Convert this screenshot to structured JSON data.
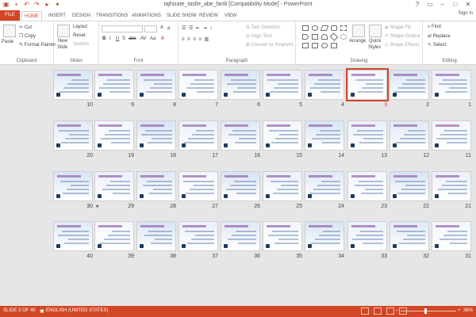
{
  "window": {
    "title": "tajhizate_tasfie_abe_fardi [Compatibility Mode] - PowerPoint",
    "controls": [
      "?",
      "▭",
      "–",
      "□",
      "✕"
    ]
  },
  "ribbon_tabs": [
    "FILE",
    "HOME",
    "INSERT",
    "DESIGN",
    "TRANSITIONS",
    "ANIMATIONS",
    "SLIDE SHOW",
    "REVIEW",
    "VIEW"
  ],
  "signin": "Sign in",
  "clipboard": {
    "paste": "Paste",
    "cut": "Cut",
    "copy": "Copy",
    "format_painter": "Format Painter",
    "label": "Clipboard"
  },
  "slides_group": {
    "new_slide": "New",
    "new_slide2": "Slide",
    "layout": "Layout",
    "reset": "Reset",
    "section": "Section",
    "label": "Slides"
  },
  "font_group": {
    "bold": "B",
    "italic": "I",
    "underline": "U",
    "strike": "S",
    "abc": "abc",
    "av": "AV",
    "aa": "Aa",
    "label": "Font"
  },
  "paragraph_group": {
    "text_direction": "Text Direction",
    "align_text": "Align Text",
    "convert": "Convert to SmartArt",
    "label": "Paragraph"
  },
  "drawing_group": {
    "arrange": "Arrange",
    "quick_styles": "Quick",
    "quick_styles2": "Styles",
    "shape_fill": "Shape Fill",
    "shape_outline": "Shape Outline",
    "shape_effects": "Shape Effects",
    "label": "Drawing"
  },
  "editing_group": {
    "find": "Find",
    "replace": "Replace",
    "select": "Select",
    "label": "Editing"
  },
  "slides": [
    {
      "n": "10"
    },
    {
      "n": "9"
    },
    {
      "n": "8"
    },
    {
      "n": "7"
    },
    {
      "n": "6"
    },
    {
      "n": "5"
    },
    {
      "n": "4"
    },
    {
      "n": "3"
    },
    {
      "n": "2"
    },
    {
      "n": "1"
    },
    {
      "n": "20"
    },
    {
      "n": "19"
    },
    {
      "n": "18"
    },
    {
      "n": "17"
    },
    {
      "n": "16"
    },
    {
      "n": "15"
    },
    {
      "n": "14"
    },
    {
      "n": "13"
    },
    {
      "n": "12"
    },
    {
      "n": "11"
    },
    {
      "n": "30"
    },
    {
      "n": "29"
    },
    {
      "n": "28"
    },
    {
      "n": "27"
    },
    {
      "n": "26"
    },
    {
      "n": "25"
    },
    {
      "n": "24"
    },
    {
      "n": "23"
    },
    {
      "n": "22"
    },
    {
      "n": "21"
    },
    {
      "n": "40"
    },
    {
      "n": "39"
    },
    {
      "n": "38"
    },
    {
      "n": "37"
    },
    {
      "n": "36"
    },
    {
      "n": "35"
    },
    {
      "n": "34"
    },
    {
      "n": "33"
    },
    {
      "n": "32"
    },
    {
      "n": "31"
    }
  ],
  "selected_slide": "3",
  "slide_star": "★",
  "status": {
    "slide_of": "SLIDE 3 OF 40",
    "language": "ENGLISH (UNITED STATES)",
    "zoom": "36%",
    "minus": "–",
    "plus": "+"
  },
  "colors": {
    "accent": "#d24726",
    "pane_bg": "#e6e6e6"
  }
}
